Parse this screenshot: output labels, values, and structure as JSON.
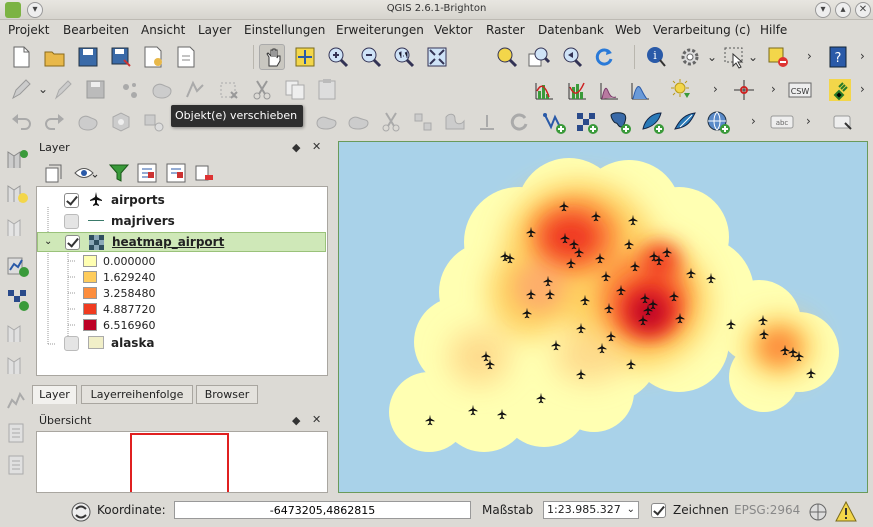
{
  "window": {
    "title": "QGIS 2.6.1-Brighton"
  },
  "menu": [
    "Projekt",
    "Bearbeiten",
    "Ansicht",
    "Layer",
    "Einstellungen",
    "Erweiterungen",
    "Vektor",
    "Raster",
    "Datenbank",
    "Web",
    "Verarbeitung (c)",
    "Hilfe"
  ],
  "tooltip": "Objekt(e) verschieben",
  "layers_panel": {
    "title": "Layer",
    "layers": [
      {
        "name": "airports",
        "checked": true,
        "icon": "airplane-icon"
      },
      {
        "name": "majrivers",
        "checked": false,
        "icon": "line-icon"
      },
      {
        "name": "heatmap_airport",
        "checked": true,
        "icon": "raster-icon",
        "selected": true
      },
      {
        "name": "alaska",
        "checked": false,
        "icon": "polygon-icon"
      }
    ],
    "legend": [
      {
        "value": "0.000000",
        "color": "#ffffb2"
      },
      {
        "value": "1.629240",
        "color": "#fecc5c"
      },
      {
        "value": "3.258480",
        "color": "#fd8d3c"
      },
      {
        "value": "4.887720",
        "color": "#f03b20"
      },
      {
        "value": "6.516960",
        "color": "#bd0026"
      }
    ]
  },
  "tabs": [
    "Layer",
    "Layerreihenfolge",
    "Browser"
  ],
  "overview_panel": {
    "title": "Übersicht"
  },
  "statusbar": {
    "coord_label": "Koordinate:",
    "coord_value": "-6473205,4862815",
    "scale_label": "Maßstab",
    "scale_value": "1:23.985.327",
    "render_label": "Zeichnen",
    "crs": "EPSG:2964"
  }
}
